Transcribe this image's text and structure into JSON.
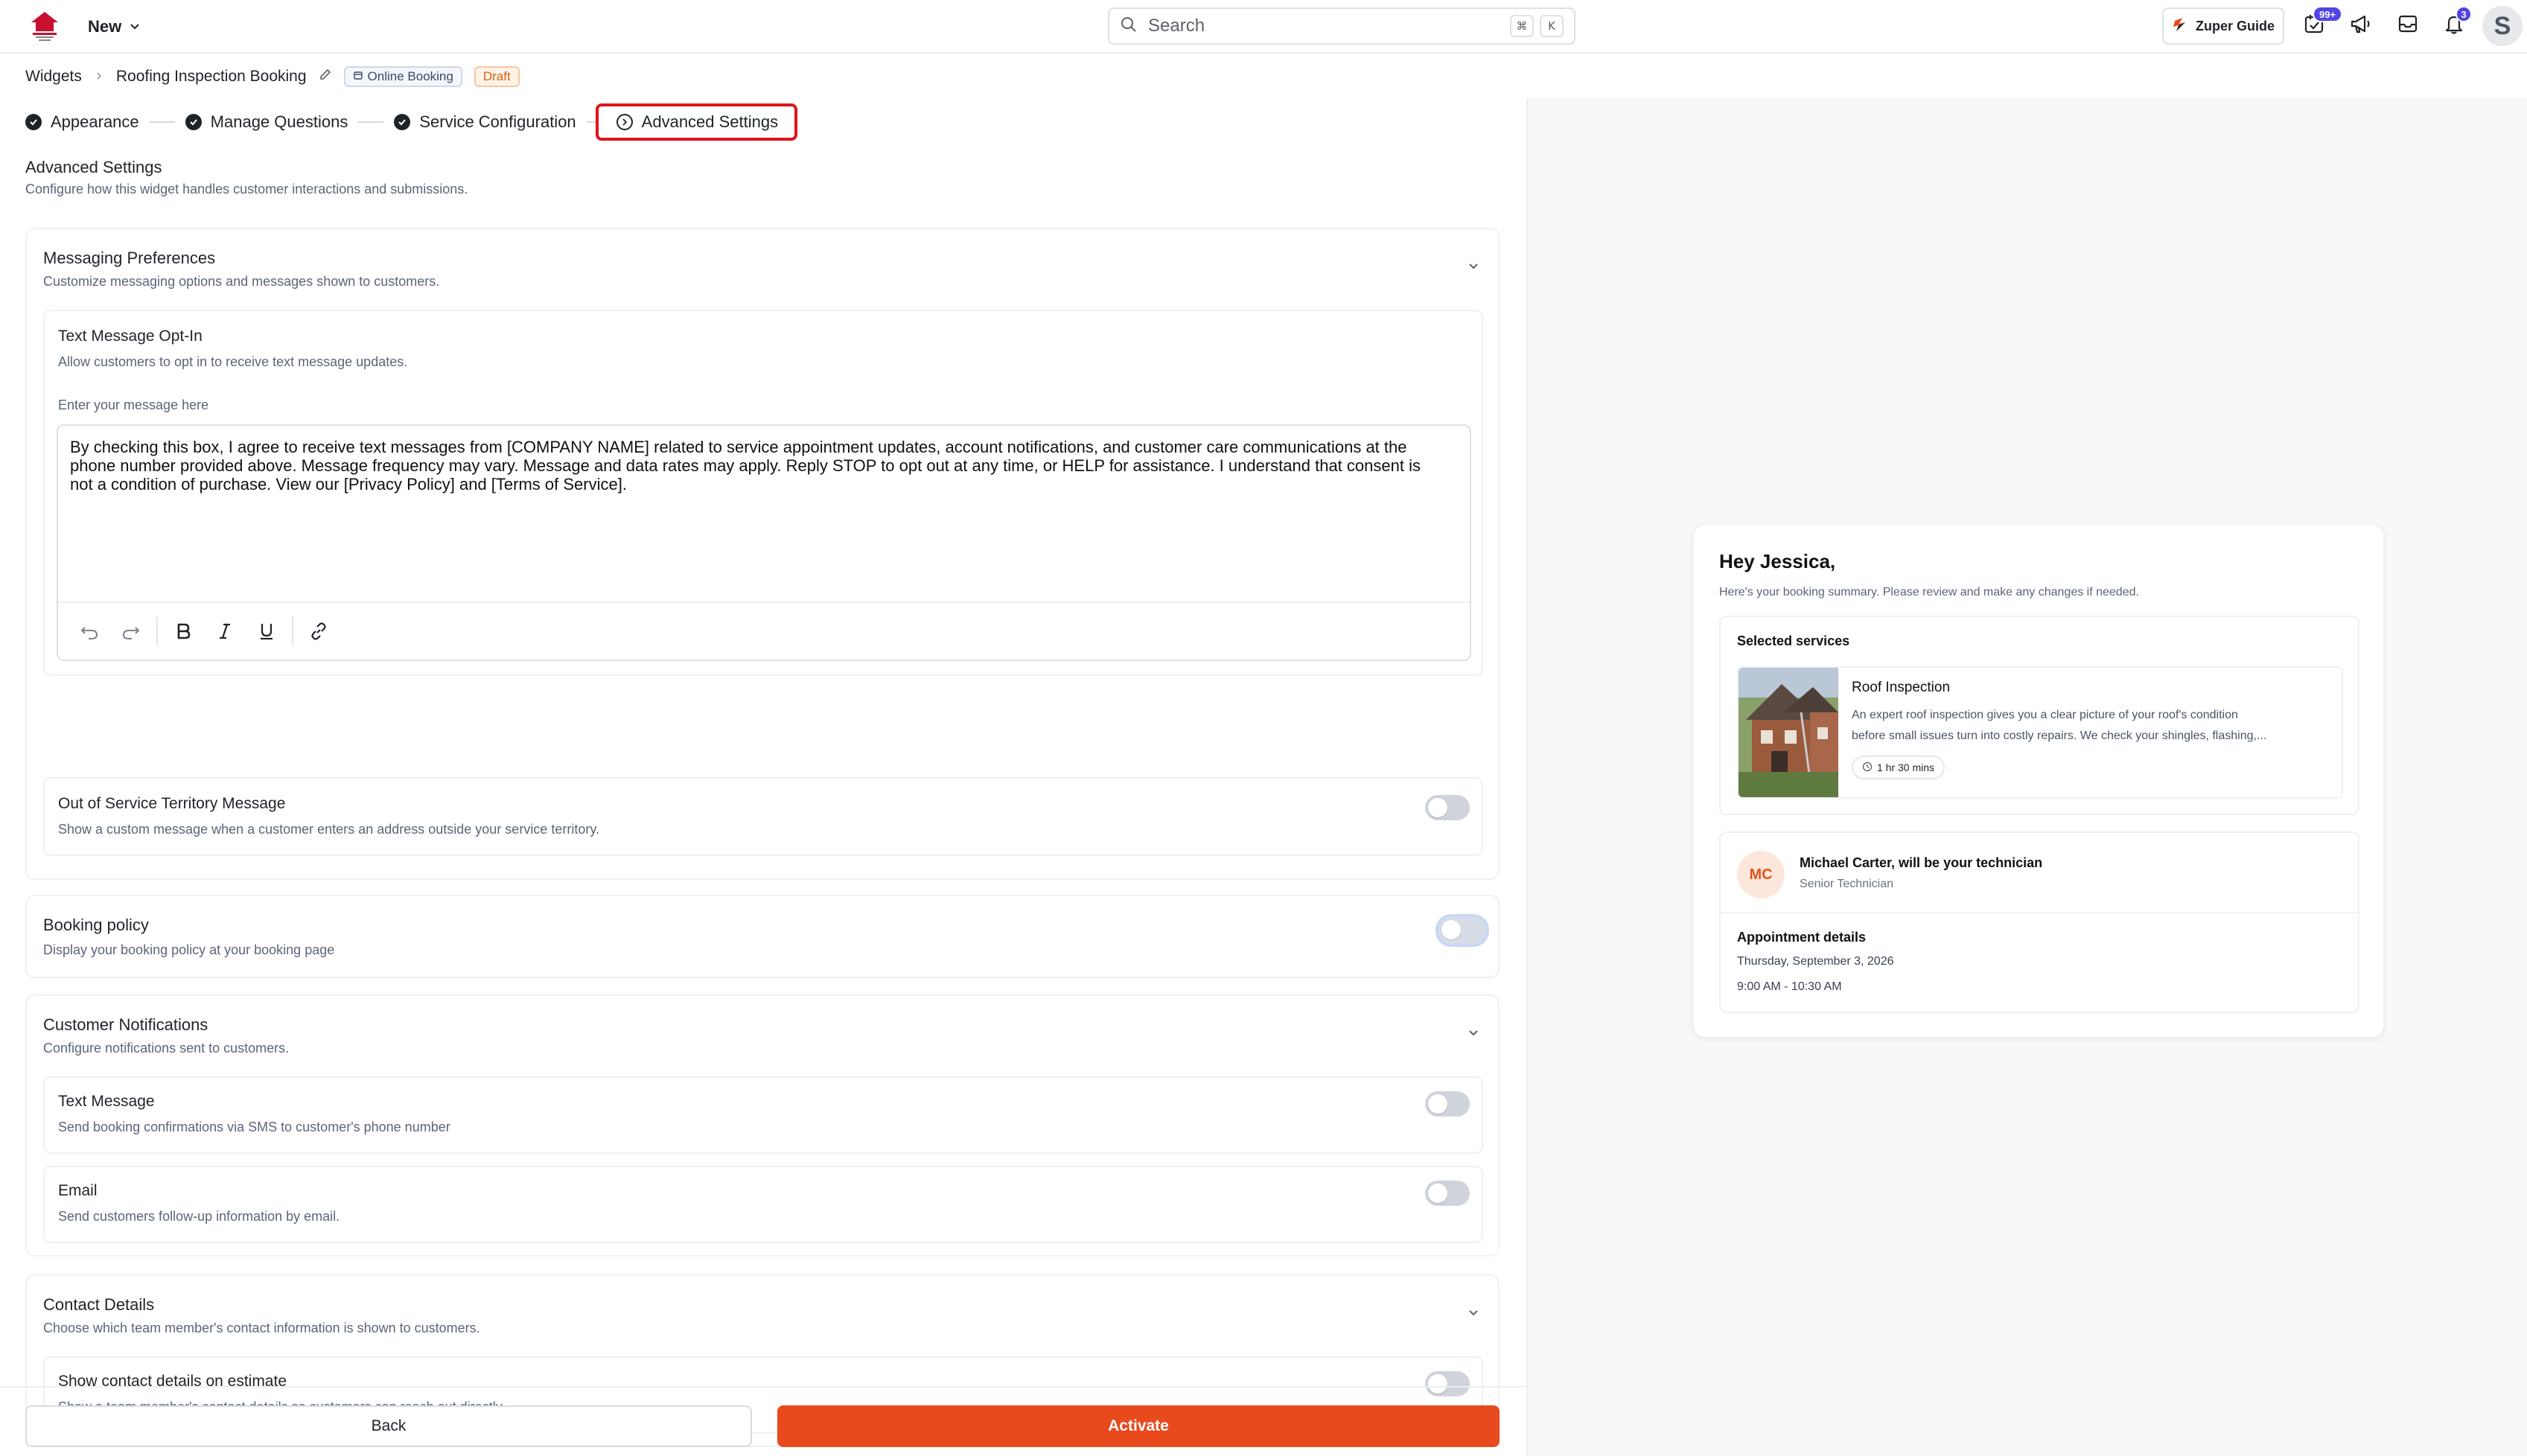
{
  "header": {
    "new_label": "New",
    "search_placeholder": "Search",
    "kbd_cmd": "⌘",
    "kbd_k": "K",
    "guide_label": "Zuper Guide",
    "tasks_badge": "99+",
    "notif_badge": "3",
    "avatar_letter": "S"
  },
  "breadcrumb": {
    "root": "Widgets",
    "current": "Roofing Inspection Booking",
    "tag_online": "Online Booking",
    "tag_draft": "Draft"
  },
  "stepper": {
    "steps": [
      "Appearance",
      "Manage Questions",
      "Service Configuration",
      "Advanced Settings"
    ],
    "active_index": 3
  },
  "section": {
    "title": "Advanced Settings",
    "subtitle": "Configure how this widget handles customer interactions and submissions."
  },
  "messaging": {
    "title": "Messaging Preferences",
    "subtitle": "Customize messaging options and messages shown to customers.",
    "opt_in": {
      "title": "Text Message Opt-In",
      "subtitle": "Allow customers to opt in to receive text message updates.",
      "field_label": "Enter your message here",
      "message_lines": [
        "By checking this box, I agree to receive text messages from [COMPANY NAME] related to service appointment updates, account notifications, and customer care communications at the",
        "phone number provided above. Message frequency may vary. Message and data rates may apply. Reply STOP to opt out at any time, or HELP for assistance. I understand that consent is",
        "not a condition of purchase. View our [Privacy Policy] and [Terms of Service]."
      ]
    },
    "out_of_territory": {
      "title": "Out of Service Territory Message",
      "subtitle": "Show a custom message when a customer enters an address outside your service territory.",
      "enabled": false
    }
  },
  "booking_policy": {
    "title": "Booking policy",
    "subtitle": "Display your booking policy at your booking page",
    "enabled": false
  },
  "notifications": {
    "title": "Customer Notifications",
    "subtitle": "Configure notifications sent to customers.",
    "text_message": {
      "title": "Text Message",
      "subtitle": "Send booking confirmations via SMS to customer's phone number",
      "enabled": false
    },
    "email": {
      "title": "Email",
      "subtitle": "Send customers follow-up information by email.",
      "enabled": false
    }
  },
  "contact": {
    "title": "Contact Details",
    "subtitle": "Choose which team member's contact information is shown to customers.",
    "estimate": {
      "title": "Show contact details on estimate",
      "subtitle": "Show a team member's contact details so customers can reach out directly.",
      "enabled": false
    }
  },
  "footer": {
    "back_label": "Back",
    "activate_label": "Activate"
  },
  "preview": {
    "greeting": "Hey Jessica,",
    "summary": "Here's your booking summary. Please review and make any changes if needed.",
    "services_title": "Selected services",
    "service_name": "Roof Inspection",
    "service_desc_lines": [
      "An expert roof inspection gives you a clear picture of your roof's condition",
      "before small issues turn into costly repairs. We check your shingles, flashing,..."
    ],
    "duration": "1 hr 30 mins",
    "tech_initials": "MC",
    "tech_name": "Michael Carter, will be your technician",
    "tech_role": "Senior Technician",
    "appt_title": "Appointment details",
    "appt_date": "Thursday, September 3, 2026",
    "appt_time": "9:00 AM - 10:30 AM"
  },
  "colors": {
    "accent": "#e8491d",
    "highlight": "#e0131b",
    "badge": "#4f46e5"
  }
}
